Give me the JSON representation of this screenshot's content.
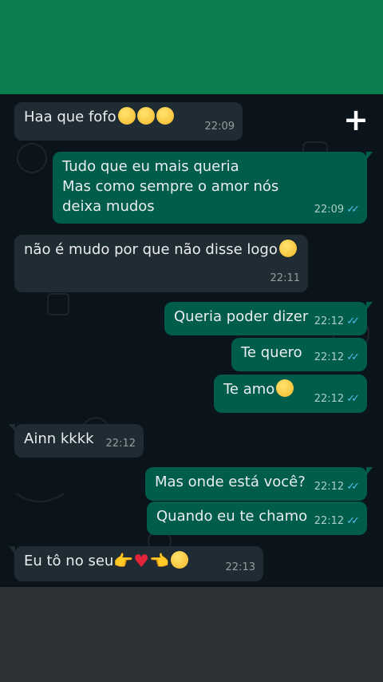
{
  "messages": [
    {
      "id": "m1",
      "text": "Haa que fofo",
      "time": "22:09"
    },
    {
      "id": "m2",
      "text": "Tudo que eu mais queria\nMas como sempre o amor nós deixa mudos",
      "time": "22:09"
    },
    {
      "id": "m3",
      "text": "não é mudo por que não disse logo",
      "time": "22:11"
    },
    {
      "id": "m4",
      "text": "Queria poder dizer",
      "time": "22:12"
    },
    {
      "id": "m5",
      "text": "Te quero",
      "time": "22:12"
    },
    {
      "id": "m6",
      "text": "Te amo",
      "time": "22:12"
    },
    {
      "id": "m7",
      "text": "Ainn kkkk",
      "time": "22:12"
    },
    {
      "id": "m8",
      "text": "Mas onde está você?",
      "time": "22:12"
    },
    {
      "id": "m9",
      "text": "Quando eu te chamo",
      "time": "22:12"
    },
    {
      "id": "m10",
      "text": "Eu tô no seu",
      "time": "22:13"
    }
  ],
  "icons": {
    "add": "plus-icon",
    "read": "double-check-icon"
  },
  "colors": {
    "header": "#0a7e4f",
    "incoming": "#202c33",
    "outgoing": "#005c4b",
    "read_ticks": "#53bdeb"
  }
}
